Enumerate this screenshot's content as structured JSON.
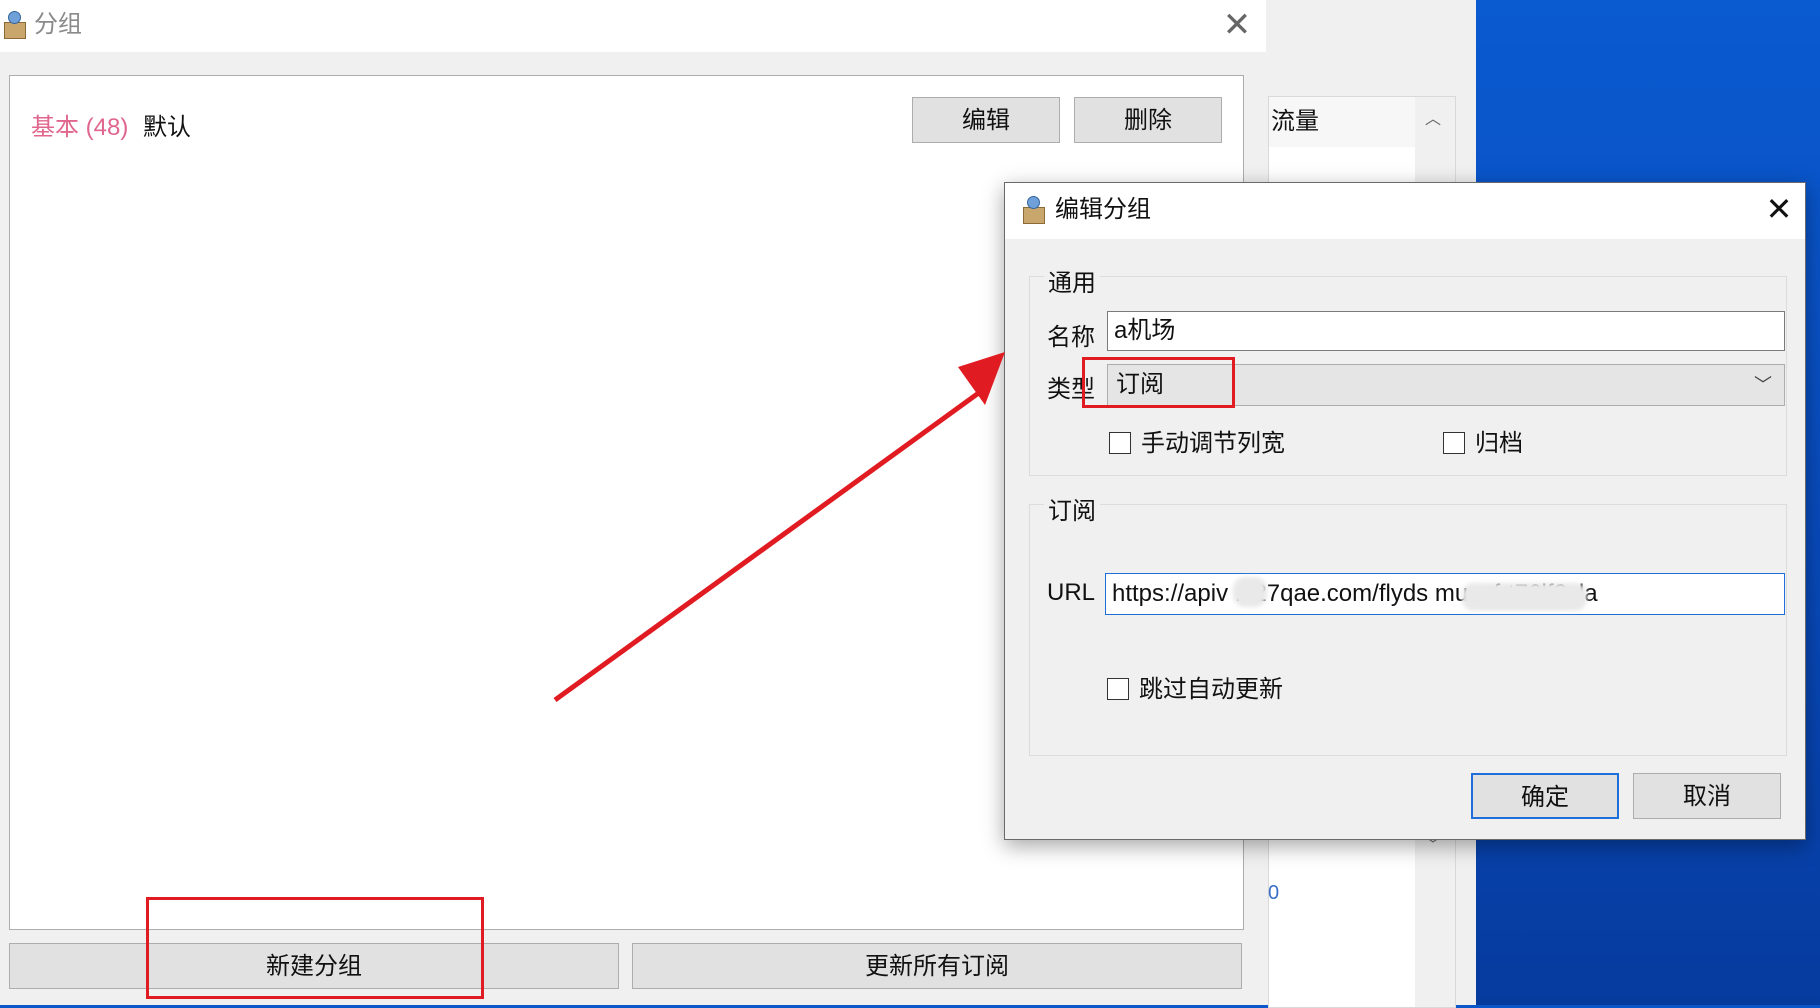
{
  "main_window": {
    "title": "分组",
    "close_glyph": "✕",
    "group_prefix": "基本 (48)",
    "group_name": "默认",
    "edit_button": "编辑",
    "delete_button": "删除",
    "new_group_button": "新建分组",
    "update_all_button": "更新所有订阅"
  },
  "background_window": {
    "list_header": "流量",
    "partial_value": "0"
  },
  "edit_dialog": {
    "title": "编辑分组",
    "close_glyph": "✕",
    "general_legend": "通用",
    "name_label": "名称",
    "name_value": "a机场",
    "type_label": "类型",
    "type_value": "订阅",
    "manual_column_width": "手动调节列宽",
    "archive": "归档",
    "subscription_legend": "订阅",
    "url_label": "URL",
    "url_value": "https://apiv   .v27qae.com/flyds                    muavfrt76lf?cla",
    "skip_auto_update": "跳过自动更新",
    "ok_button": "确定",
    "cancel_button": "取消"
  },
  "colors": {
    "annotation": "#e11b22",
    "group_prefix": "#e0668d",
    "focus_border": "#1e6fd9",
    "desktop": "#0a57c9"
  },
  "icons": {
    "app": "app-person-box-icon",
    "dropdown": "chevron-down-icon",
    "scroll_up": "chevron-up-icon",
    "scroll_down": "chevron-down-icon"
  }
}
